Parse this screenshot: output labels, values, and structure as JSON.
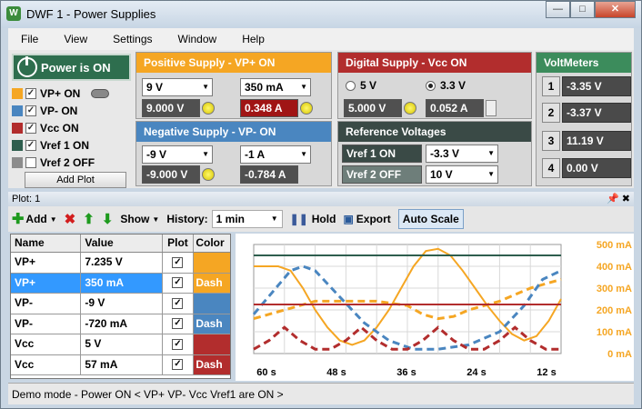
{
  "window": {
    "title": "DWF 1 - Power Supplies"
  },
  "menu": [
    "File",
    "View",
    "Settings",
    "Window",
    "Help"
  ],
  "power": {
    "label": "Power is ON"
  },
  "channels": [
    {
      "label": "VP+ ON",
      "checked": true,
      "color": "#f5a623"
    },
    {
      "label": "VP- ON",
      "checked": true,
      "color": "#4a86c0"
    },
    {
      "label": "Vcc ON",
      "checked": true,
      "color": "#b22d2d"
    },
    {
      "label": "Vref 1 ON",
      "checked": true,
      "color": "#2e5e4e"
    },
    {
      "label": "Vref 2 OFF",
      "checked": false,
      "color": "#8c8c8c"
    }
  ],
  "add_plot": "Add Plot",
  "positive": {
    "header": "Positive Supply - VP+ ON",
    "voltage_set": "9 V",
    "current_set": "350 mA",
    "voltage_read": "9.000 V",
    "current_read": "0.348 A"
  },
  "negative": {
    "header": "Negative Supply - VP- ON",
    "voltage_set": "-9 V",
    "current_set": "-1 A",
    "voltage_read": "-9.000 V",
    "current_read": "-0.784 A"
  },
  "digital": {
    "header": "Digital Supply - Vcc ON",
    "opt1": "5 V",
    "opt2": "3.3 V",
    "voltage_read": "5.000 V",
    "current_read": "0.052 A"
  },
  "reference": {
    "header": "Reference Voltages",
    "vref1_label": "Vref 1 ON",
    "vref1_value": "-3.3 V",
    "vref2_label": "Vref 2 OFF",
    "vref2_value": "10 V"
  },
  "voltmeters": {
    "header": "VoltMeters",
    "items": [
      {
        "num": "1",
        "value": "-3.35 V"
      },
      {
        "num": "2",
        "value": "-3.37 V"
      },
      {
        "num": "3",
        "value": "11.19 V"
      },
      {
        "num": "4",
        "value": "0.00 V"
      }
    ]
  },
  "plot": {
    "tab": "Plot: 1",
    "toolbar": {
      "add": "Add",
      "show": "Show",
      "history_label": "History:",
      "history_value": "1 min",
      "hold": "Hold",
      "export": "Export",
      "autoscale": "Auto Scale"
    },
    "table": {
      "headers": [
        "Name",
        "Value",
        "Plot",
        "Color"
      ],
      "rows": [
        {
          "name": "VP+",
          "value": "7.235 V",
          "color": "#f5a623",
          "color_label": ""
        },
        {
          "name": "VP+",
          "value": "350 mA",
          "color": "#f5a623",
          "color_label": "Dash"
        },
        {
          "name": "VP-",
          "value": "-9 V",
          "color": "#4a86c0",
          "color_label": ""
        },
        {
          "name": "VP-",
          "value": "-720 mA",
          "color": "#4a86c0",
          "color_label": "Dash"
        },
        {
          "name": "Vcc",
          "value": "5 V",
          "color": "#b22d2d",
          "color_label": ""
        },
        {
          "name": "Vcc",
          "value": "57 mA",
          "color": "#b22d2d",
          "color_label": "Dash"
        }
      ]
    }
  },
  "status": "Demo mode - Power ON < VP+ VP- Vcc Vref1 are ON >",
  "chart_data": {
    "type": "line",
    "x_ticks": [
      "60 s",
      "48 s",
      "36 s",
      "24 s",
      "12 s"
    ],
    "y2_ticks": [
      "500 mA",
      "400 mA",
      "300 mA",
      "200 mA",
      "100 mA",
      "0 mA"
    ],
    "y2_range": [
      0,
      500
    ],
    "grid": true,
    "series": [
      {
        "color": "#f5a623",
        "dash": false,
        "points": [
          [
            0,
            400
          ],
          [
            8,
            400
          ],
          [
            12,
            380
          ],
          [
            16,
            300
          ],
          [
            20,
            200
          ],
          [
            24,
            120
          ],
          [
            28,
            60
          ],
          [
            32,
            40
          ],
          [
            36,
            60
          ],
          [
            40,
            120
          ],
          [
            44,
            200
          ],
          [
            48,
            300
          ],
          [
            52,
            400
          ],
          [
            56,
            470
          ],
          [
            60,
            480
          ],
          [
            64,
            450
          ],
          [
            68,
            380
          ],
          [
            72,
            300
          ],
          [
            76,
            220
          ],
          [
            80,
            150
          ],
          [
            84,
            90
          ],
          [
            88,
            60
          ],
          [
            92,
            80
          ],
          [
            96,
            150
          ],
          [
            100,
            250
          ]
        ]
      },
      {
        "color": "#f5a623",
        "dash": true,
        "points": [
          [
            0,
            160
          ],
          [
            10,
            200
          ],
          [
            20,
            240
          ],
          [
            30,
            240
          ],
          [
            40,
            240
          ],
          [
            50,
            220
          ],
          [
            55,
            180
          ],
          [
            60,
            160
          ],
          [
            65,
            170
          ],
          [
            70,
            200
          ],
          [
            80,
            240
          ],
          [
            90,
            300
          ],
          [
            100,
            340
          ]
        ]
      },
      {
        "color": "#4a86c0",
        "dash": true,
        "points": [
          [
            0,
            180
          ],
          [
            6,
            280
          ],
          [
            12,
            380
          ],
          [
            16,
            400
          ],
          [
            20,
            380
          ],
          [
            28,
            260
          ],
          [
            36,
            140
          ],
          [
            44,
            60
          ],
          [
            52,
            20
          ],
          [
            60,
            20
          ],
          [
            70,
            40
          ],
          [
            80,
            100
          ],
          [
            88,
            220
          ],
          [
            94,
            340
          ],
          [
            100,
            380
          ]
        ]
      },
      {
        "color": "#b22d2d",
        "dash": true,
        "points": [
          [
            0,
            20
          ],
          [
            5,
            60
          ],
          [
            10,
            120
          ],
          [
            15,
            60
          ],
          [
            20,
            20
          ],
          [
            25,
            20
          ],
          [
            30,
            60
          ],
          [
            35,
            120
          ],
          [
            40,
            60
          ],
          [
            45,
            20
          ],
          [
            50,
            20
          ],
          [
            55,
            60
          ],
          [
            60,
            120
          ],
          [
            65,
            60
          ],
          [
            70,
            20
          ],
          [
            75,
            20
          ],
          [
            80,
            60
          ],
          [
            85,
            120
          ],
          [
            90,
            60
          ],
          [
            95,
            20
          ],
          [
            100,
            20
          ]
        ]
      },
      {
        "color": "#b22d2d",
        "dash": false,
        "points": [
          [
            0,
            225
          ],
          [
            100,
            225
          ]
        ]
      },
      {
        "color": "#2e5e4e",
        "dash": false,
        "points": [
          [
            0,
            450
          ],
          [
            100,
            450
          ]
        ]
      }
    ]
  }
}
